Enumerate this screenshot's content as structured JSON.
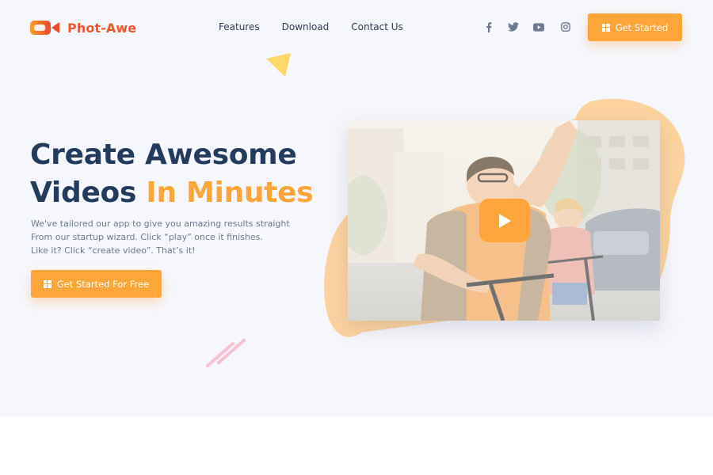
{
  "brand": {
    "name": "Phot-Awe"
  },
  "nav": {
    "items": [
      {
        "label": "Features"
      },
      {
        "label": "Download"
      },
      {
        "label": "Contact Us"
      }
    ]
  },
  "social": {
    "icons": [
      "facebook-icon",
      "twitter-icon",
      "youtube-icon",
      "instagram-icon"
    ]
  },
  "header_cta": {
    "label": "Get Started",
    "icon": "windows-icon"
  },
  "hero": {
    "headline_line1": "Create Awesome",
    "headline_line2_prefix": "Videos ",
    "headline_line2_accent": "In Minutes",
    "description_line1": "We've tailored our app to give you amazing results straight",
    "description_line2": "From our startup wizard. Click “play” once it finishes.",
    "description_line3": "Like it? Click “create video”. That’s it!",
    "cta_label": "Get Started For Free",
    "cta_icon": "windows-icon"
  },
  "video": {
    "play_icon": "play-icon"
  },
  "colors": {
    "accent": "#ffa53a",
    "brand": "#f0562f",
    "heading": "#233b5d",
    "background": "#f6f7fc"
  }
}
